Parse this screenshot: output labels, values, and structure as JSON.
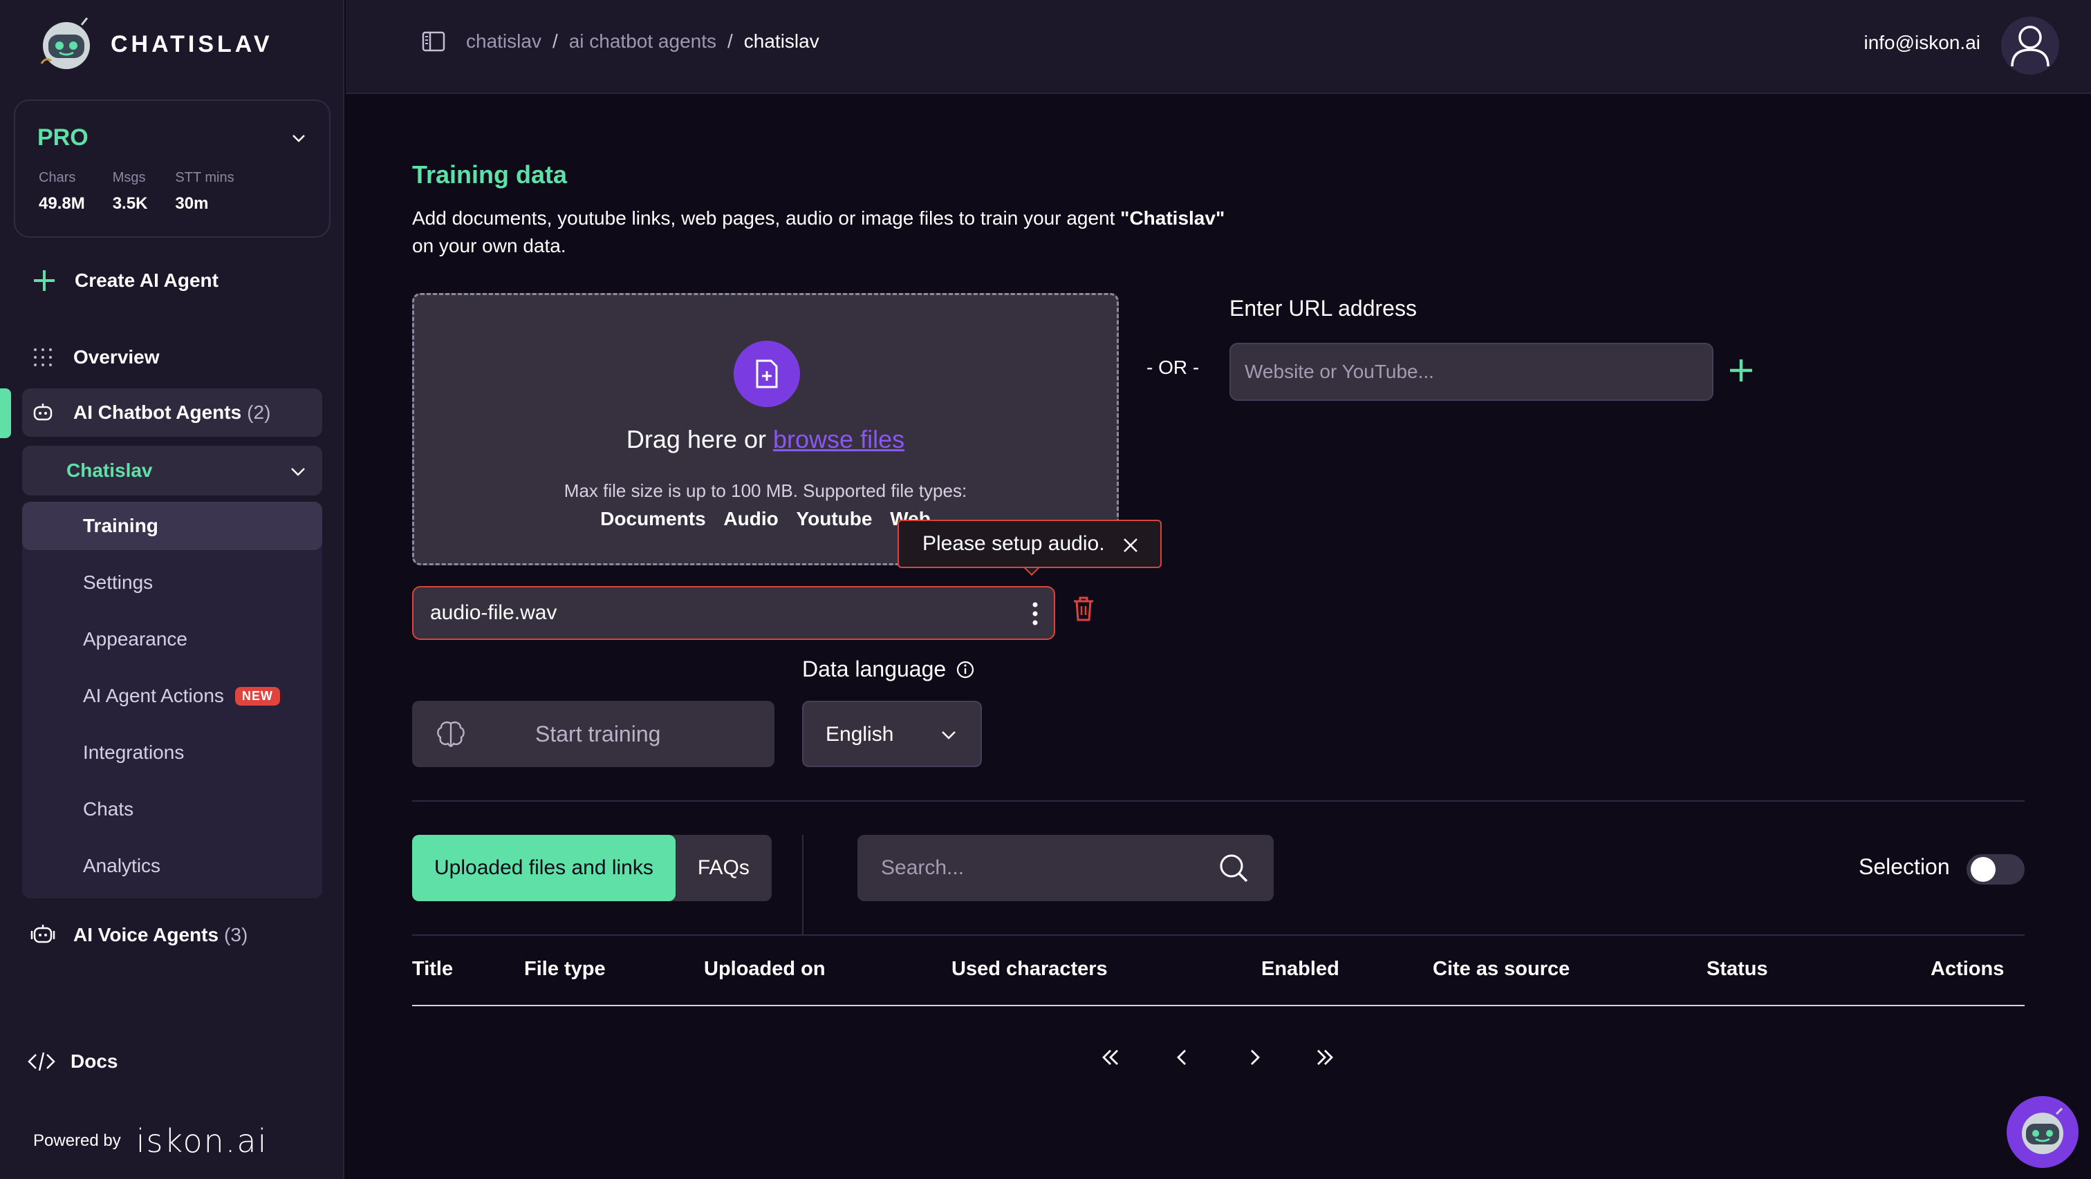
{
  "brand": {
    "name": "CHATISLAV"
  },
  "plan": {
    "name": "PRO",
    "stats": [
      {
        "label": "Chars",
        "value": "49.8M"
      },
      {
        "label": "Msgs",
        "value": "3.5K"
      },
      {
        "label": "STT mins",
        "value": "30m"
      }
    ]
  },
  "sidebar": {
    "create_label": "Create AI Agent",
    "overview_label": "Overview",
    "chatbot_agents": {
      "label": "AI Chatbot Agents",
      "count": "(2)"
    },
    "agent_name": "Chatislav",
    "subnav": [
      "Training",
      "Settings",
      "Appearance",
      "AI Agent Actions",
      "Integrations",
      "Chats",
      "Analytics"
    ],
    "new_badge": "NEW",
    "voice_agents": {
      "label": "AI Voice Agents",
      "count": "(3)"
    },
    "docs_label": "Docs",
    "powered_by": "Powered by",
    "powered_logo": "iskon.ai"
  },
  "header": {
    "breadcrumbs": [
      "chatislav",
      "ai chatbot agents",
      "chatislav"
    ],
    "separator": "/",
    "user_email": "info@iskon.ai"
  },
  "training": {
    "title": "Training data",
    "desc_prefix": "Add documents, youtube links, web pages, audio or image files to train your agent ",
    "agent_quoted": "\"Chatislav\"",
    "desc_suffix": "on your own data.",
    "drag_text": "Drag here or ",
    "browse_link": "browse files",
    "max_text": "Max file size is up to 100 MB. Supported file types:",
    "types": [
      "Documents",
      "Audio",
      "Youtube",
      "Web"
    ],
    "or_text": "- OR -",
    "url_label": "Enter URL address",
    "url_placeholder": "Website or YouTube...",
    "tooltip": "Please setup audio.",
    "file_name": "audio-file.wav",
    "data_language_label": "Data language",
    "start_training": "Start training",
    "language_value": "English"
  },
  "list": {
    "tabs": [
      "Uploaded files and links",
      "FAQs"
    ],
    "search_placeholder": "Search...",
    "selection_label": "Selection",
    "selection_on": false,
    "columns": [
      "Title",
      "File type",
      "Uploaded on",
      "Used characters",
      "Enabled",
      "Cite as source",
      "Status",
      "Actions"
    ]
  },
  "colors": {
    "accent": "#5fe0a6",
    "brand_purple": "#7a3ce0",
    "error": "#d9453d"
  }
}
